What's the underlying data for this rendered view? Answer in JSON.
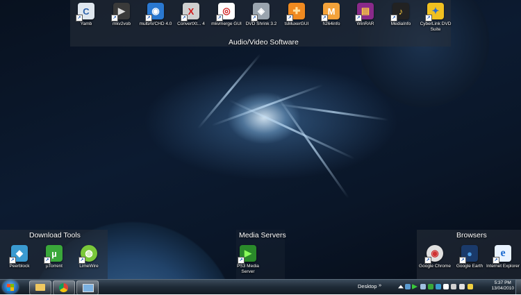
{
  "groups": {
    "audio_video": {
      "title": "Audio/Video Software"
    },
    "download_tools": {
      "title": "Download Tools"
    },
    "media_servers": {
      "title": "Media Servers"
    },
    "browsers": {
      "title": "Browsers"
    }
  },
  "icons": {
    "yamb": {
      "label": "Yamb",
      "glyph": "C",
      "color": "#dfe6ee",
      "fg": "#2a5fa8"
    },
    "mkv2vob": {
      "label": "mkv2vob",
      "glyph": "▶",
      "color": "#3a3a3a",
      "fg": "#dddddd"
    },
    "multiavchd": {
      "label": "multiAVCHD 4.0",
      "glyph": "◉",
      "color": "#2a78d0",
      "fg": "#ffffff"
    },
    "convertxtodvd": {
      "label": "ConvertXt... 4",
      "glyph": "X",
      "color": "#cfcfcf",
      "fg": "#d01818"
    },
    "mkvmerge": {
      "label": "mkvmerge GUI",
      "glyph": "◎",
      "color": "#ffffff",
      "fg": "#d02020"
    },
    "dvdshrink": {
      "label": "DVD Shrink 3.2",
      "glyph": "◈",
      "color": "#9aa4ae",
      "fg": "#ffffff"
    },
    "tsmuxer": {
      "label": "tsMuxerGUI",
      "glyph": "✚",
      "color": "#f08a20",
      "fg": "#ffe0a0"
    },
    "h264info": {
      "label": "h264info",
      "glyph": "M",
      "color": "#f3a23a",
      "fg": "#ffffff"
    },
    "winrar": {
      "label": "WinRAR",
      "glyph": "▤",
      "color": "#8a2a8a",
      "fg": "#ffd040"
    },
    "mediainfo": {
      "label": "MediaInfo",
      "glyph": "♪",
      "color": "#222222",
      "fg": "#ffd040"
    },
    "cyberlink": {
      "label": "CyberLink DVD Suite",
      "glyph": "✦",
      "color": "#f0c020",
      "fg": "#2a6ad0"
    },
    "peerblock": {
      "label": "Peerblock",
      "glyph": "◆",
      "color": "#3a9ad0",
      "fg": "#ffffff"
    },
    "utorrent": {
      "label": "µTorrent",
      "glyph": "µ",
      "color": "#3aa83a",
      "fg": "#ffffff"
    },
    "limewire": {
      "label": "LimeWire",
      "glyph": "◍",
      "color": "#7ac83a",
      "fg": "#ffffff"
    },
    "ps3mediaserver": {
      "label": "PS3 Media Server",
      "glyph": "▶",
      "color": "#2a8a2a",
      "fg": "#8aff5a"
    },
    "chrome": {
      "label": "Google Chrome",
      "glyph": "◉",
      "color": "#e0e0e0",
      "fg": "#d03030"
    },
    "googleearth": {
      "label": "Google Earth",
      "glyph": "●",
      "color": "#1a3a6a",
      "fg": "#4a9ae0"
    },
    "ie": {
      "label": "Internet Explorer",
      "glyph": "e",
      "color": "#e8f2ff",
      "fg": "#1a6ad0"
    }
  },
  "taskbar": {
    "desktop_label": "Desktop",
    "chevron": "»",
    "clock_time": "5:37 PM",
    "clock_date": "13/04/2010"
  }
}
